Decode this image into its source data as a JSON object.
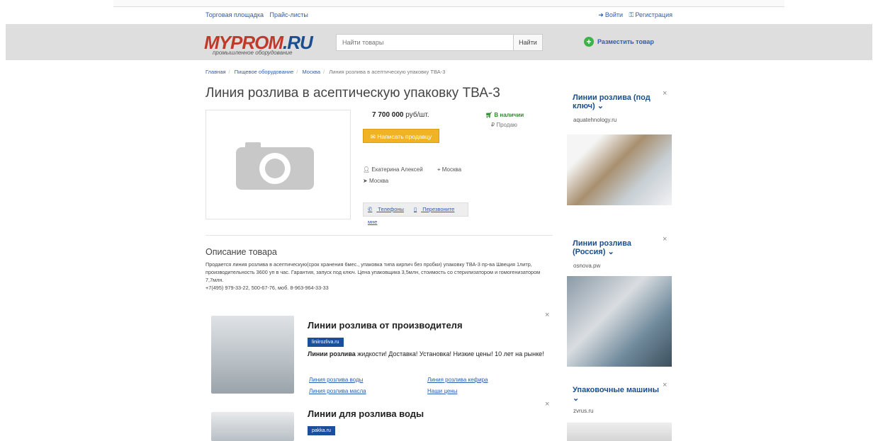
{
  "topbar": {
    "marketplace": "Торговая площадка",
    "pricelists": "Прайс-листы",
    "login": "Войти",
    "register": "Регистрация"
  },
  "header": {
    "logo_main": "MYPROM",
    "logo_ru": ".RU",
    "logo_sub": "промышленное оборудование",
    "search_placeholder": "Найти товары",
    "search_button": "Найти",
    "post_item": "Разместить товар"
  },
  "breadcrumbs": [
    "Главная",
    "Пищевое оборудование",
    "Москва",
    "Линия розлива в асептическую упаковку ТВА-3"
  ],
  "product": {
    "title": "Линия розлива в асептическую упаковку ТВА-3",
    "price": "7 700 000",
    "price_unit": "руб/шт.",
    "stock": "В наличии",
    "deal_type": "Продаю",
    "write_seller": "Написать продавцу",
    "seller": "Екатерина Алексей",
    "city": "Москва",
    "delivery_city": "Москва",
    "phones": "Телефоны",
    "callback": "Перезвоните мне"
  },
  "description": {
    "heading": "Описание товара",
    "text": "Продается линия розлива в асептическую(срок хранения 6мес., упаковка типа кирпич без пробки) упаковку ТВА-3 пр-ва Швеция 1литр, производительность 3600 уп в час. Гарантия, запуск под ключ. Цена упаковщика 3,5млн, стоимость со стерилизатором и гомогенизатором 7,7млн.",
    "contacts": "+7(495) 979-33-22, 500-67-76, моб. 8-963-964-33-33"
  },
  "ads": [
    {
      "title": "Линии розлива от производителя",
      "domain": "liniirozliva.ru",
      "text_bold": "Линии розлива",
      "text": " жидкости! Доставка! Установка! Низкие цены! 10 лет на рынке!",
      "links": [
        "Линия розлива воды",
        "Линия розлива кефира",
        "Линия розлива масла",
        "Наши цены"
      ]
    },
    {
      "title": "Линии для розлива воды",
      "domain": "pakka.ru"
    }
  ],
  "side_ads": [
    {
      "title": "Линии розлива (под ключ)",
      "domain": "aquatehnology.ru"
    },
    {
      "title": "Линии розлива (Россия)",
      "domain": "osnova.pw"
    },
    {
      "title": "Упаковочные машины",
      "domain": "zvrus.ru"
    }
  ],
  "colors": {
    "accent_orange": "#f0b323",
    "link_blue": "#2a5db0",
    "stock_green": "#2e8b2e",
    "logo_red": "#c0392b"
  }
}
